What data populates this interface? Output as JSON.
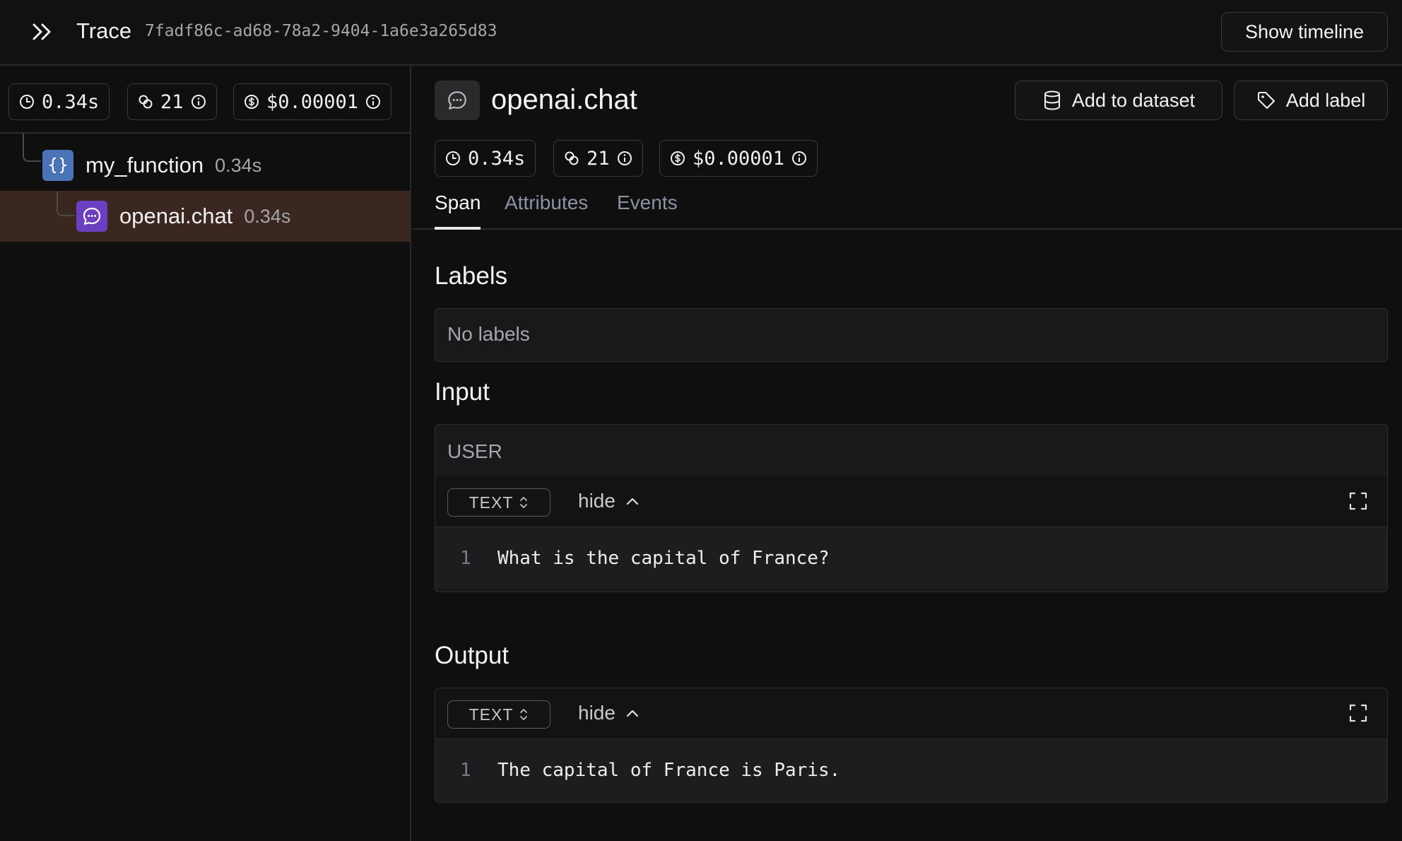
{
  "header": {
    "title": "Trace",
    "trace_id": "7fadf86c-ad68-78a2-9404-1a6e3a265d83",
    "show_timeline_label": "Show timeline"
  },
  "trace_stats": {
    "duration": "0.34s",
    "tokens": "21",
    "cost": "$0.00001"
  },
  "tree": [
    {
      "name": "my_function",
      "duration": "0.34s",
      "icon": "braces-icon",
      "color": "#4a73b8"
    },
    {
      "name": "openai.chat",
      "duration": "0.34s",
      "icon": "chat-icon",
      "color": "#6b3fc0",
      "selected": true
    }
  ],
  "span": {
    "title": "openai.chat",
    "duration": "0.34s",
    "tokens": "21",
    "cost": "$0.00001",
    "add_to_dataset_label": "Add to dataset",
    "add_label_label": "Add label",
    "tabs": [
      "Span",
      "Attributes",
      "Events"
    ],
    "active_tab": "Span"
  },
  "labels_section": {
    "title": "Labels",
    "empty_text": "No labels"
  },
  "input_section": {
    "title": "Input",
    "role": "USER",
    "format": "TEXT",
    "hide_label": "hide",
    "line_number": "1",
    "content": "What is the capital of France?"
  },
  "output_section": {
    "title": "Output",
    "format": "TEXT",
    "hide_label": "hide",
    "line_number": "1",
    "content": "The capital of France is Paris."
  },
  "colors": {
    "selected_row": "#3a2820",
    "function_icon": "#4a73b8",
    "llm_icon": "#6b3fc0"
  }
}
